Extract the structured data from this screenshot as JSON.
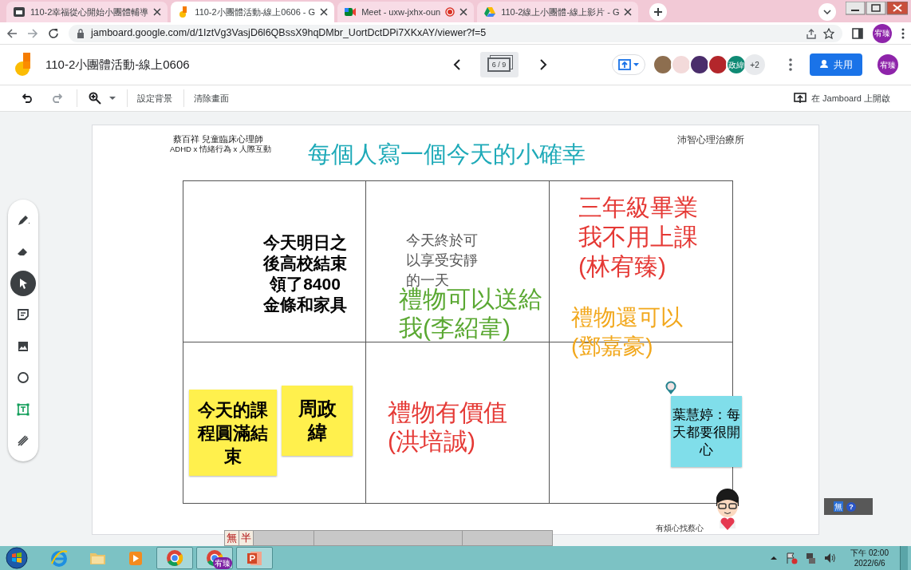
{
  "browser": {
    "tabs": [
      {
        "kind": "doc",
        "title": "110-2幸福從心開始小團體輔導",
        "selected": false
      },
      {
        "kind": "jamboard",
        "title": "110-2小團體活動-線上0606 - G",
        "selected": true
      },
      {
        "kind": "meet",
        "title": "Meet - uxw-jxhx-oun",
        "selected": false,
        "recording": true
      },
      {
        "kind": "drive",
        "title": "110-2線上小團體-線上影片 - G",
        "selected": false
      }
    ],
    "url": "jamboard.google.com/d/1IztVg3VasjD6l6QBssX9hqDMbr_UortDctDPi7XKxAY/viewer?f=5",
    "profile": "宥臻"
  },
  "app": {
    "title": "110-2小團體活動-線上0606",
    "frame_counter": "6 / 9",
    "collaborators": [
      {
        "color": "#8d6e4f"
      },
      {
        "color": "#f3dada"
      },
      {
        "color": "#4a2d6b"
      },
      {
        "color": "#b3262b"
      },
      {
        "label": "政緯",
        "color": "#0f8a74"
      }
    ],
    "more_count": "+2",
    "share_button": "共用",
    "profile": "宥臻"
  },
  "toolbar": {
    "actions": [
      "設定背景",
      "清除畫面"
    ],
    "open_in_app": "在 Jamboard 上開啟"
  },
  "tools": [
    {
      "kind": "pen",
      "selected": false
    },
    {
      "kind": "eraser",
      "selected": false
    },
    {
      "kind": "select",
      "selected": true
    },
    {
      "kind": "sticky",
      "selected": false
    },
    {
      "kind": "image",
      "selected": false
    },
    {
      "kind": "shape",
      "selected": false
    },
    {
      "kind": "textbox",
      "selected": false
    },
    {
      "kind": "laser",
      "selected": false
    }
  ],
  "board": {
    "author": "蔡百祥 兒童臨床心理師",
    "subtitle": "ADHD x 情緒行為 x 人際互動",
    "clinic": "沛智心理治療所",
    "title": "每個人寫一個今天的小確幸",
    "tagline": "有煩心找蔡心",
    "notes": [
      {
        "kind": "text",
        "text": "今天明日之後高校結束領了8400金條和家具",
        "color": "#000000"
      },
      {
        "kind": "text",
        "text": "今天終於可以享受安靜的一天",
        "color": "#555555"
      },
      {
        "kind": "text",
        "text": "禮物可以送給我(李紹韋)",
        "color": "#5aa832"
      },
      {
        "kind": "text",
        "text": "三年級畢業我不用上課(林宥臻)",
        "color": "#e53935"
      },
      {
        "kind": "text",
        "text": "禮物還可以(鄧嘉豪)",
        "color": "#f2a81d"
      },
      {
        "kind": "sticky",
        "text": "今天的課程圓滿結束",
        "color": "#fff04d"
      },
      {
        "kind": "sticky",
        "text": "周政緯",
        "color": "#fff04d"
      },
      {
        "kind": "text",
        "text": "禮物有價值(洪培誠)",
        "color": "#e53935"
      },
      {
        "kind": "sticky",
        "text": "葉慧婷：每天都要很開心",
        "color": "#80deea"
      }
    ]
  },
  "ime_bar": {
    "mode": "無",
    "width": "半"
  },
  "ime_float": {
    "mode": "無",
    "help": "?"
  },
  "taskbar": {
    "apps": [
      {
        "kind": "ie"
      },
      {
        "kind": "folder"
      },
      {
        "kind": "media"
      },
      {
        "kind": "chrome"
      },
      {
        "kind": "chrome",
        "badge": "宥臻"
      },
      {
        "kind": "powerpoint"
      }
    ],
    "time": "下午 02:00",
    "date": "2022/6/6"
  }
}
